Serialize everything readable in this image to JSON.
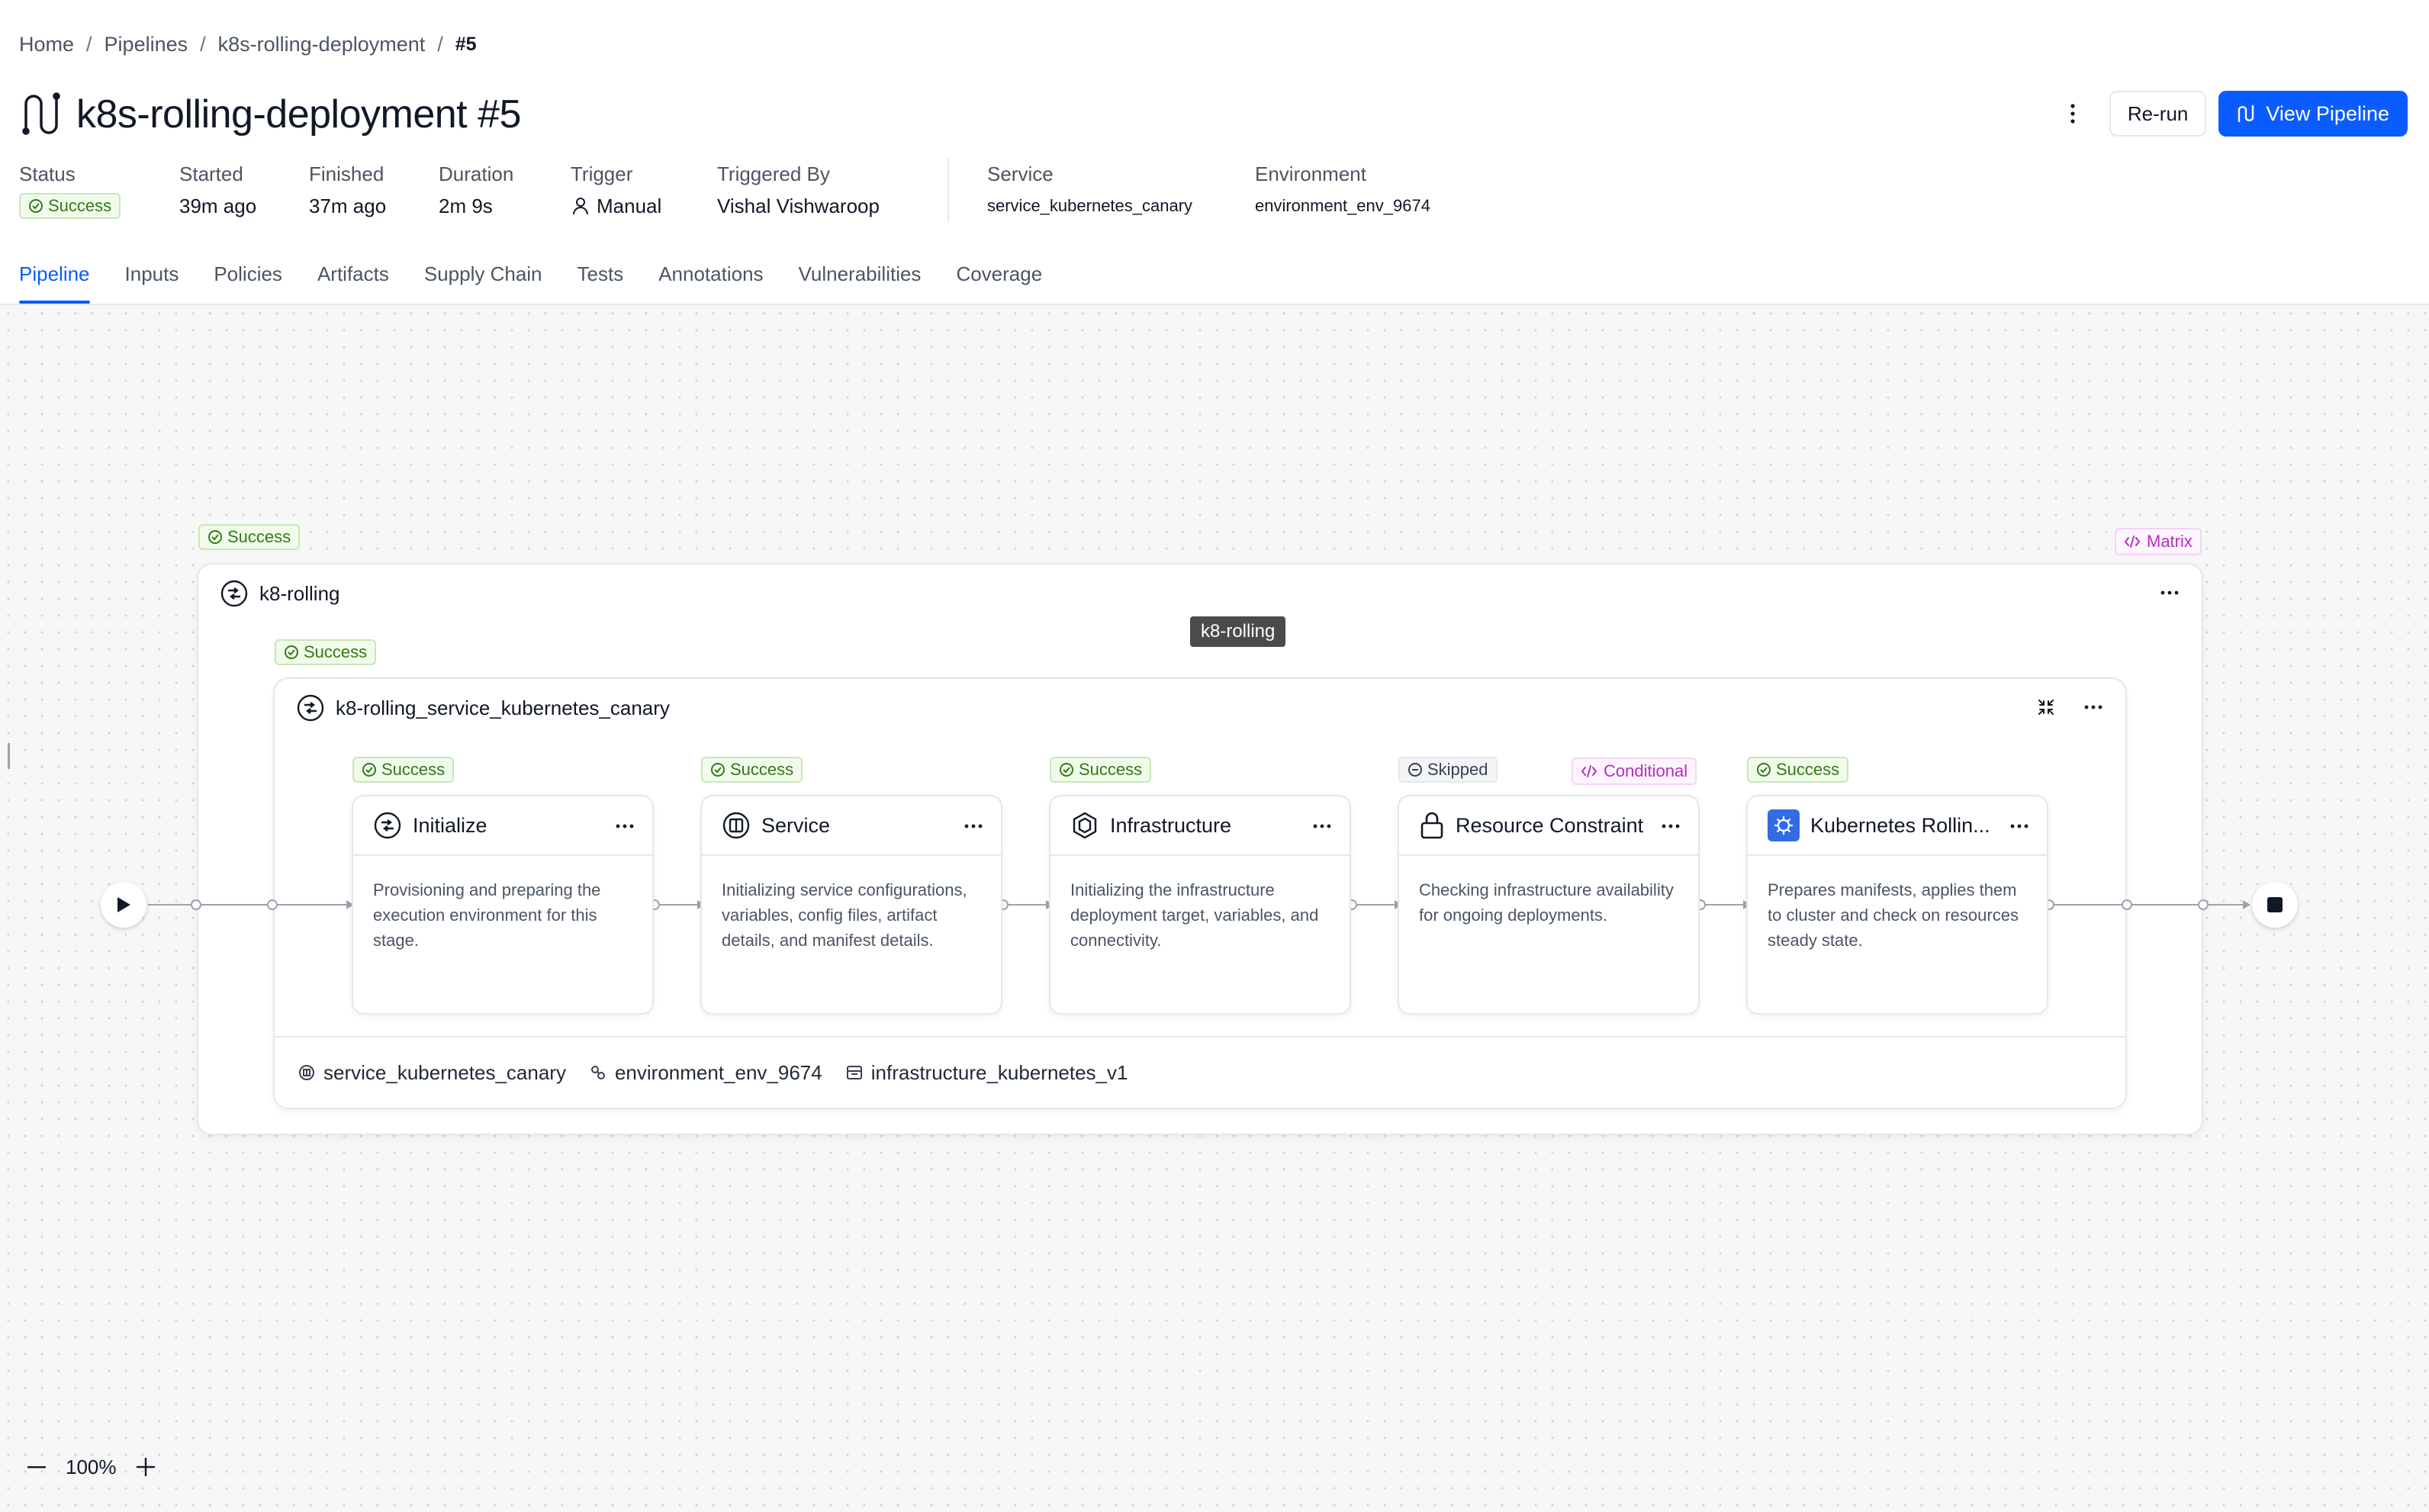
{
  "breadcrumb": {
    "home": "Home",
    "pipelines": "Pipelines",
    "pipeline": "k8s-rolling-deployment",
    "current": "#5"
  },
  "header": {
    "title": "k8s-rolling-deployment #5",
    "rerun_label": "Re-run",
    "view_pipeline_label": "View Pipeline"
  },
  "meta": {
    "status_label": "Status",
    "status_value": "Success",
    "started_label": "Started",
    "started_value": "39m ago",
    "finished_label": "Finished",
    "finished_value": "37m ago",
    "duration_label": "Duration",
    "duration_value": "2m 9s",
    "trigger_label": "Trigger",
    "trigger_value": "Manual",
    "triggered_by_label": "Triggered By",
    "triggered_by_value": "Vishal Vishwaroop",
    "service_label": "Service",
    "service_value": "service_kubernetes_canary",
    "environment_label": "Environment",
    "environment_value": "environment_env_9674"
  },
  "tabs": [
    "Pipeline",
    "Inputs",
    "Policies",
    "Artifacts",
    "Supply Chain",
    "Tests",
    "Annotations",
    "Vulnerabilities",
    "Coverage"
  ],
  "canvas": {
    "outer_stage": {
      "name": "k8-rolling",
      "status": "Success",
      "matrix_label": "Matrix",
      "tooltip": "k8-rolling"
    },
    "inner_stage": {
      "name": "k8-rolling_service_kubernetes_canary",
      "status": "Success",
      "footer": {
        "service": "service_kubernetes_canary",
        "environment": "environment_env_9674",
        "infrastructure": "infrastructure_kubernetes_v1"
      }
    },
    "steps": [
      {
        "name": "Initialize",
        "status": "Success",
        "description": "Provisioning and preparing the execution environment for this stage.",
        "icon": "initialize-icon"
      },
      {
        "name": "Service",
        "status": "Success",
        "description": "Initializing service configurations, variables, config files, artifact details, and manifest details.",
        "icon": "service-icon"
      },
      {
        "name": "Infrastructure",
        "status": "Success",
        "description": "Initializing the infrastructure deployment target, variables, and connectivity.",
        "icon": "infrastructure-icon"
      },
      {
        "name": "Resource Constraint",
        "status": "Skipped",
        "conditional_label": "Conditional",
        "description": "Checking infrastructure availability for ongoing deployments.",
        "icon": "lock-icon"
      },
      {
        "name": "Kubernetes Rollin...",
        "status": "Success",
        "description": "Prepares manifests, applies them to cluster and check on resources steady state.",
        "icon": "kubernetes-icon"
      }
    ],
    "zoom": "100%"
  },
  "colors": {
    "accent": "#0b5cff",
    "success_text": "#2f7d17",
    "success_bg": "#f1faeb",
    "purple": "#b42fbf"
  }
}
